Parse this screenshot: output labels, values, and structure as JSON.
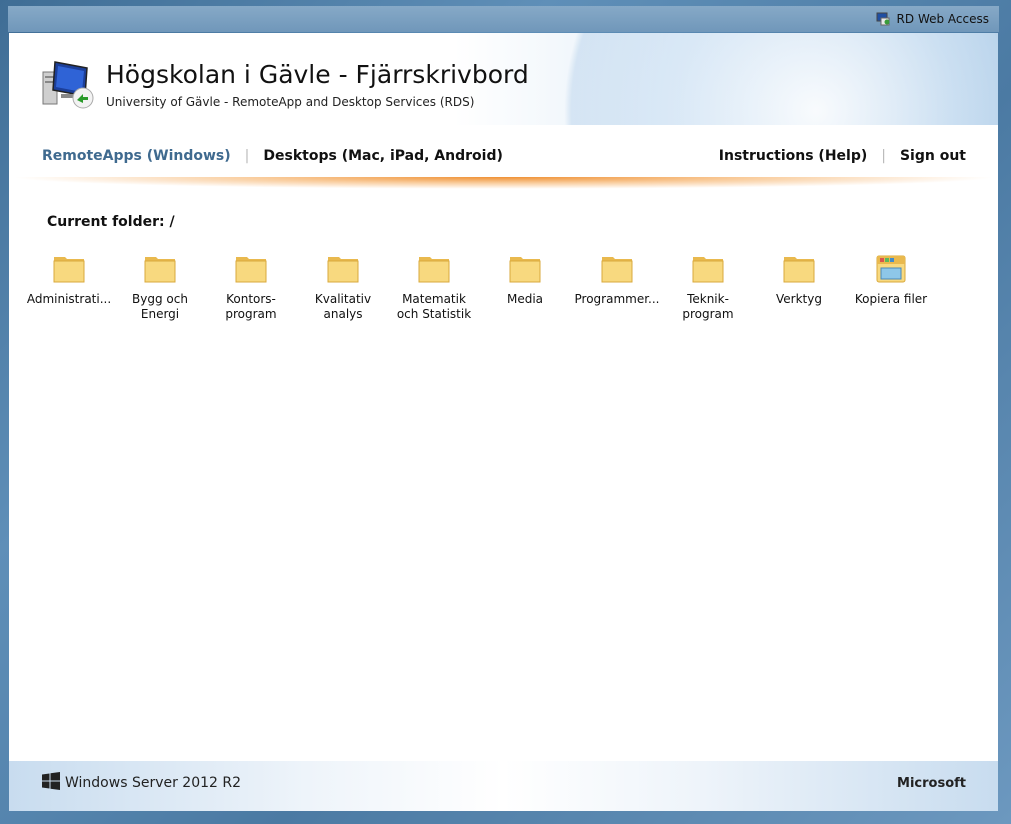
{
  "topbar": {
    "rdwa_label": "RD Web Access"
  },
  "header": {
    "title": "Högskolan i Gävle - Fjärrskrivbord",
    "subtitle": "University of Gävle - RemoteApp and Desktop Services (RDS)"
  },
  "nav": {
    "remoteapps": "RemoteApps (Windows)",
    "desktops": "Desktops (Mac, iPad, Android)",
    "instructions": "Instructions (Help)",
    "signout": "Sign out",
    "separator": "|"
  },
  "content": {
    "current_folder": "Current folder: /",
    "folders": [
      {
        "l1": "Administrati...",
        "l2": ""
      },
      {
        "l1": "Bygg och",
        "l2": "Energi"
      },
      {
        "l1": "Kontors-",
        "l2": "program"
      },
      {
        "l1": "Kvalitativ",
        "l2": "analys"
      },
      {
        "l1": "Matematik",
        "l2": "och Statistik"
      },
      {
        "l1": "Media",
        "l2": ""
      },
      {
        "l1": "Programmer...",
        "l2": ""
      },
      {
        "l1": "Teknik-",
        "l2": "program"
      },
      {
        "l1": "Verktyg",
        "l2": ""
      }
    ],
    "app": {
      "l1": "Kopiera filer",
      "l2": ""
    }
  },
  "footer": {
    "windows_server": "Windows Server 2012 R2",
    "microsoft": "Microsoft"
  },
  "icons": {
    "folder": "folder-icon",
    "app": "explorer-app-icon",
    "logo": "remote-desktop-icon",
    "windows": "windows-logo-icon"
  },
  "colors": {
    "active_nav": "#3f6a8f",
    "folder_yellow": "#f6d67a",
    "orange_bar": "#ee8a28"
  }
}
